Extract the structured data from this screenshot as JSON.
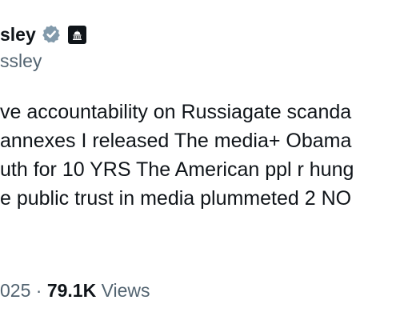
{
  "author": {
    "name_fragment": "sley",
    "handle_fragment": "ssley",
    "verified_badge_color": "#829aab",
    "affiliation_icon": "government-building-icon"
  },
  "tweet": {
    "lines": [
      "ve accountability on Russiagate scanda",
      "annexes I released The media+ Obama",
      "uth for 10 YRS The American ppl r hung",
      "e public trust in media plummeted 2 NO"
    ]
  },
  "meta": {
    "date_fragment": "025",
    "separator": "·",
    "views_count": "79.1K",
    "views_label": "Views"
  }
}
